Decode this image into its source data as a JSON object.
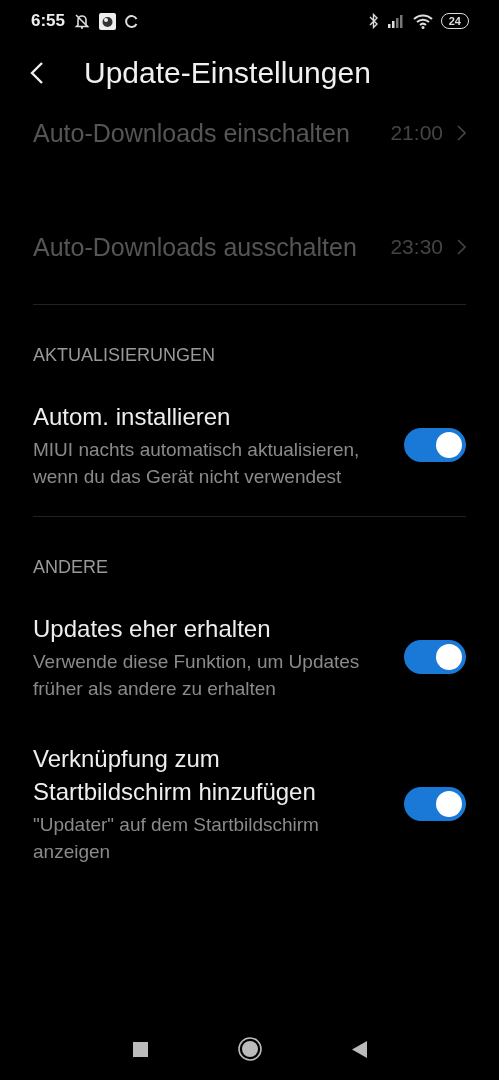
{
  "status_bar": {
    "time": "6:55",
    "battery": "24"
  },
  "header": {
    "title": "Update-Einstellungen"
  },
  "schedule": [
    {
      "title": "Auto-Downloads einschalten",
      "value": "21:00",
      "disabled": true
    },
    {
      "title": "Auto-Downloads ausschalten",
      "value": "23:30",
      "disabled": true
    }
  ],
  "sections": [
    {
      "heading": "AKTUALISIERUNGEN",
      "items": [
        {
          "title": "Autom. installieren",
          "subtitle": "MIUI nachts automatisch aktualisieren, wenn du das Gerät nicht verwendest",
          "on": true
        }
      ]
    },
    {
      "heading": "ANDERE",
      "items": [
        {
          "title": "Updates eher erhalten",
          "subtitle": "Verwende diese Funktion, um Updates früher als andere zu erhalten",
          "on": true
        },
        {
          "title": "Verknüpfung zum Startbildschirm hinzufügen",
          "subtitle": "\"Updater\" auf dem Startbildschirm anzeigen",
          "on": true
        }
      ]
    }
  ]
}
